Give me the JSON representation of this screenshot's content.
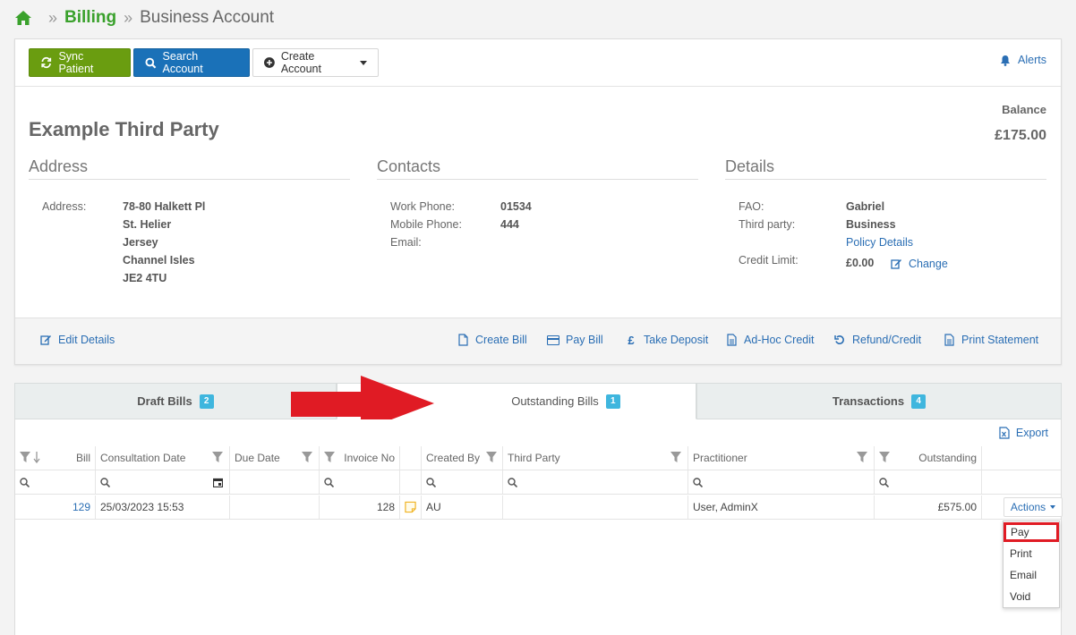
{
  "breadcrumb": {
    "parent": "Billing",
    "sep": "»",
    "current": "Business Account"
  },
  "toolbar": {
    "sync_label": "Sync Patient",
    "search_label": "Search Account",
    "create_label": "Create Account",
    "alerts_label": "Alerts"
  },
  "account": {
    "name": "Example Third Party",
    "balance_label": "Balance",
    "balance_value": "£175.00"
  },
  "address": {
    "title": "Address",
    "label": "Address:",
    "lines": [
      "78-80 Halkett Pl",
      "St. Helier",
      "Jersey",
      "Channel Isles",
      "JE2 4TU"
    ]
  },
  "contacts": {
    "title": "Contacts",
    "work_label": "Work Phone:",
    "work_value": "01534",
    "mobile_label": "Mobile Phone:",
    "mobile_value": "444",
    "email_label": "Email:"
  },
  "details": {
    "title": "Details",
    "fao_label": "FAO:",
    "fao_value": "Gabriel",
    "third_label": "Third party:",
    "third_value": "Business",
    "policy_link": "Policy Details",
    "credit_label": "Credit Limit:",
    "credit_value": "£0.00",
    "change_label": "Change"
  },
  "footer_actions": {
    "edit": "Edit Details",
    "create_bill": "Create Bill",
    "pay_bill": "Pay Bill",
    "take_deposit": "Take Deposit",
    "adhoc_credit": "Ad-Hoc Credit",
    "refund": "Refund/Credit",
    "print_statement": "Print Statement",
    "pound_glyph": "£"
  },
  "tabs": [
    {
      "label": "Draft Bills",
      "count": "2"
    },
    {
      "label": "Outstanding Bills",
      "count": "1"
    },
    {
      "label": "Transactions",
      "count": "4"
    }
  ],
  "grid": {
    "export_label": "Export",
    "columns": [
      "Bill",
      "Consultation Date",
      "Due Date",
      "Invoice No",
      "Created By",
      "Third Party",
      "Practitioner",
      "Outstanding"
    ],
    "rows": [
      {
        "bill": "129",
        "consultation_date": "25/03/2023 15:53",
        "due_date": "",
        "invoice_no": "128",
        "created_by": "AU",
        "third_party": "",
        "practitioner": "User, AdminX",
        "outstanding": "£575.00"
      }
    ],
    "actions_label": "Actions",
    "actions_menu": [
      "Pay",
      "Print",
      "Email",
      "Void"
    ]
  },
  "colors": {
    "brand_green": "#3aa12c",
    "sync_button": "#6a9d10",
    "search_button": "#1a71b8",
    "link": "#2a6eb4",
    "badge": "#3fb6de",
    "highlight_red": "#e01b24"
  }
}
